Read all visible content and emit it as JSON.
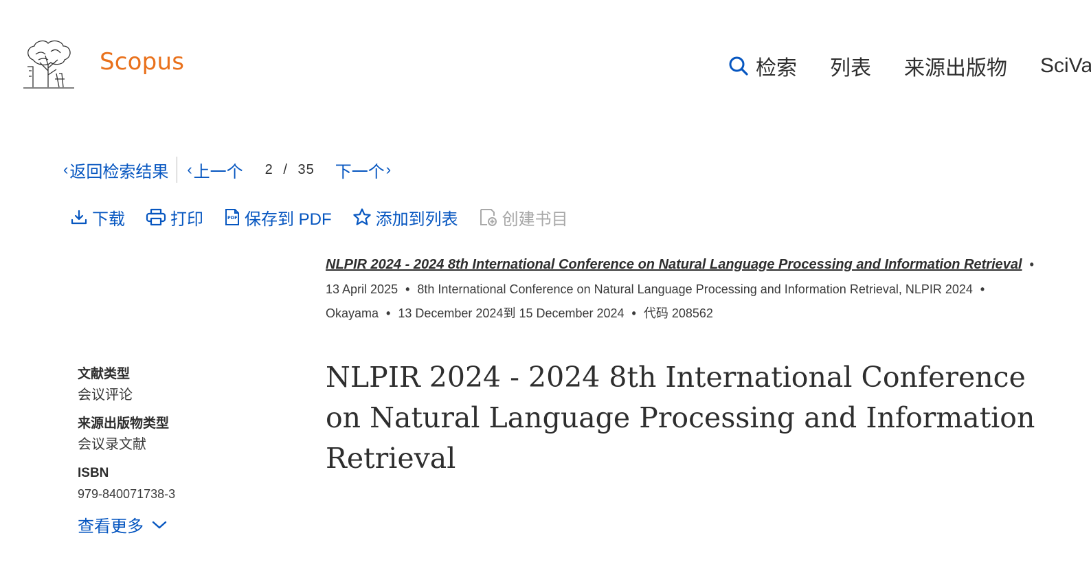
{
  "header": {
    "brand": "Scopus",
    "nav": [
      {
        "label": "检索",
        "icon": "search-icon"
      },
      {
        "label": "列表"
      },
      {
        "label": "来源出版物"
      },
      {
        "label": "SciVal"
      }
    ]
  },
  "pager": {
    "back_label": "返回检索结果",
    "prev_label": "上一个",
    "current": "2",
    "separator": "/",
    "total": "35",
    "next_label": "下一个"
  },
  "actions": {
    "download": "下载",
    "print": "打印",
    "save_pdf": "保存到 PDF",
    "add_to_list": "添加到列表",
    "create_bib": "创建书目"
  },
  "source": {
    "title_link": "NLPIR 2024 - 2024 8th International Conference on Natural Language Processing and Information Retrieval",
    "publish_date": "13 April 2025",
    "conference": "8th International Conference on Natural Language Processing and Information Retrieval, NLPIR 2024",
    "location": "Okayama",
    "date_range": "13 December 2024到 15 December 2024",
    "code": "代码 208562"
  },
  "info": {
    "doc_type_label": "文献类型",
    "doc_type_value": "会议评论",
    "source_type_label": "来源出版物类型",
    "source_type_value": "会议录文献",
    "isbn_label": "ISBN",
    "isbn_value": "979-840071738-3",
    "more_label": "查看更多"
  },
  "document": {
    "title": "NLPIR 2024 - 2024 8th International Conference on Natural Language Processing and Information Retrieval"
  },
  "colors": {
    "brand": "#e9711c",
    "link": "#0656c0",
    "text": "#2e2e2e",
    "disabled": "#a8a8a8"
  }
}
